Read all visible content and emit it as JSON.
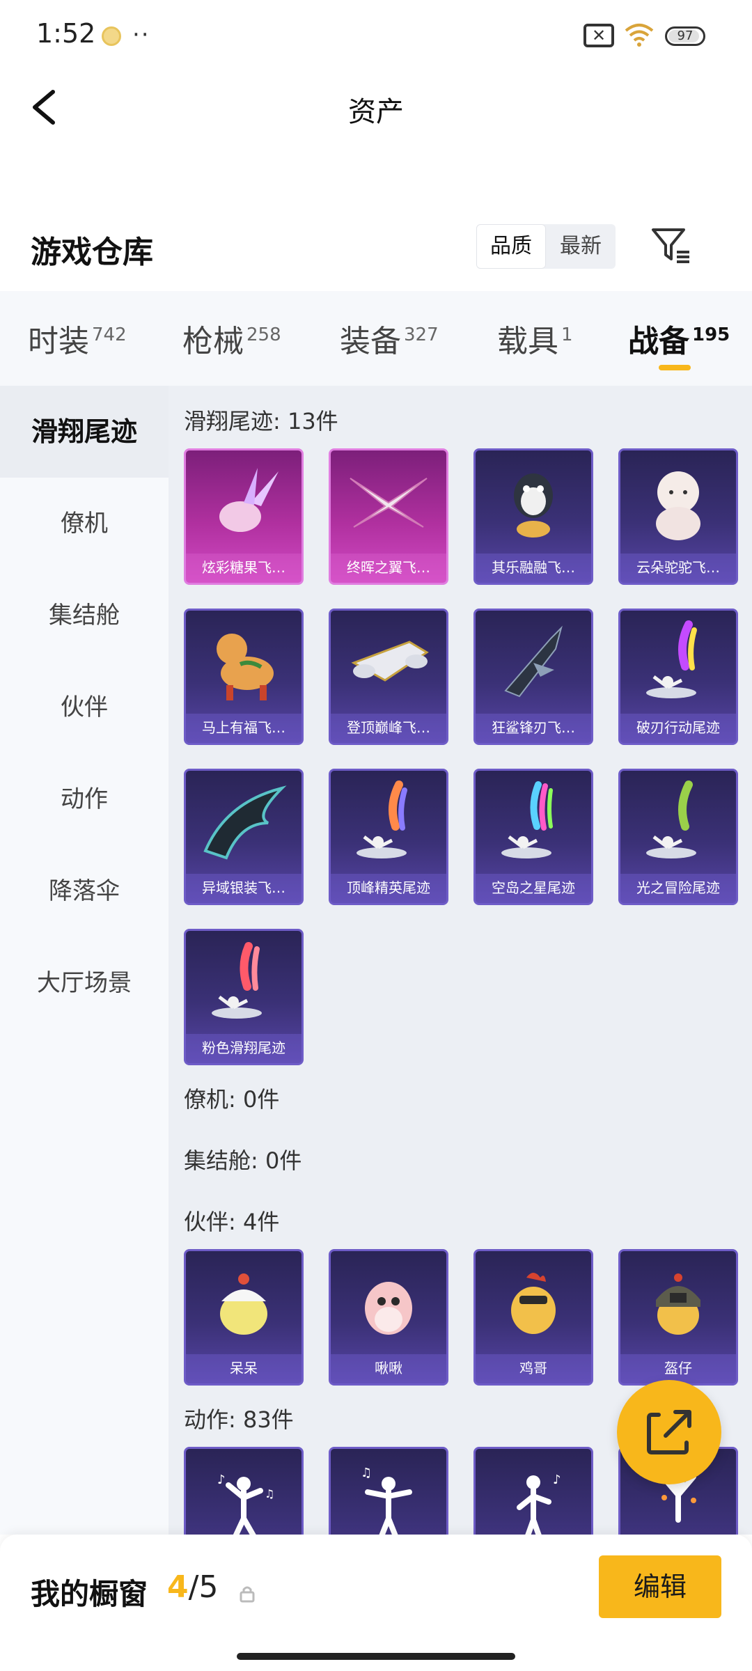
{
  "status_bar": {
    "time": "1:52",
    "dots": "··",
    "battery": "97"
  },
  "header": {
    "title": "资产",
    "back_icon": "chevron-left-icon"
  },
  "warehouse": {
    "title": "游戏仓库",
    "sort_options": [
      "品质",
      "最新"
    ],
    "sort_selected": "品质",
    "filter_icon": "filter-icon"
  },
  "tabs": [
    {
      "label": "时装",
      "count": "742"
    },
    {
      "label": "枪械",
      "count": "258"
    },
    {
      "label": "装备",
      "count": "327"
    },
    {
      "label": "载具",
      "count": "1"
    },
    {
      "label": "战备",
      "count": "195",
      "active": true
    }
  ],
  "sidebar": {
    "items": [
      "滑翔尾迹",
      "僚机",
      "集结舱",
      "伙伴",
      "动作",
      "降落伞",
      "大厅场景"
    ],
    "selected": "滑翔尾迹"
  },
  "sections": [
    {
      "title": "滑翔尾迹: 13件",
      "items": [
        {
          "label": "炫彩糖果飞…",
          "rarity": "pink"
        },
        {
          "label": "终晖之翼飞…",
          "rarity": "pink"
        },
        {
          "label": "其乐融融飞…",
          "rarity": "purple"
        },
        {
          "label": "云朵驼驼飞…",
          "rarity": "purple"
        },
        {
          "label": "马上有福飞…",
          "rarity": "purple"
        },
        {
          "label": "登顶巅峰飞…",
          "rarity": "purple"
        },
        {
          "label": "狂鲨锋刃飞…",
          "rarity": "purple"
        },
        {
          "label": "破刃行动尾迹",
          "rarity": "purple"
        },
        {
          "label": "异域银装飞…",
          "rarity": "purple"
        },
        {
          "label": "顶峰精英尾迹",
          "rarity": "purple"
        },
        {
          "label": "空岛之星尾迹",
          "rarity": "purple"
        },
        {
          "label": "光之冒险尾迹",
          "rarity": "purple"
        },
        {
          "label": "粉色滑翔尾迹",
          "rarity": "purple"
        }
      ]
    },
    {
      "title": "僚机: 0件",
      "items": []
    },
    {
      "title": "集结舱: 0件",
      "items": []
    },
    {
      "title": "伙伴: 4件",
      "items": [
        {
          "label": "呆呆",
          "rarity": "purple"
        },
        {
          "label": "啾啾",
          "rarity": "purple"
        },
        {
          "label": "鸡哥",
          "rarity": "purple"
        },
        {
          "label": "盔仔",
          "rarity": "purple"
        }
      ]
    },
    {
      "title": "动作: 83件",
      "items": [
        {
          "label": "",
          "rarity": "purple"
        },
        {
          "label": "",
          "rarity": "purple"
        },
        {
          "label": "",
          "rarity": "purple"
        },
        {
          "label": "",
          "rarity": "purple"
        }
      ]
    }
  ],
  "share_fab": {
    "icon": "share-icon"
  },
  "bottom_bar": {
    "title": "我的橱窗",
    "current": "4",
    "total": "/5",
    "lock_icon": "lock-icon",
    "edit_label": "编辑"
  },
  "colors": {
    "accent": "#f8b71b",
    "card_purple": "#3b3177",
    "card_pink": "#b0309f"
  }
}
